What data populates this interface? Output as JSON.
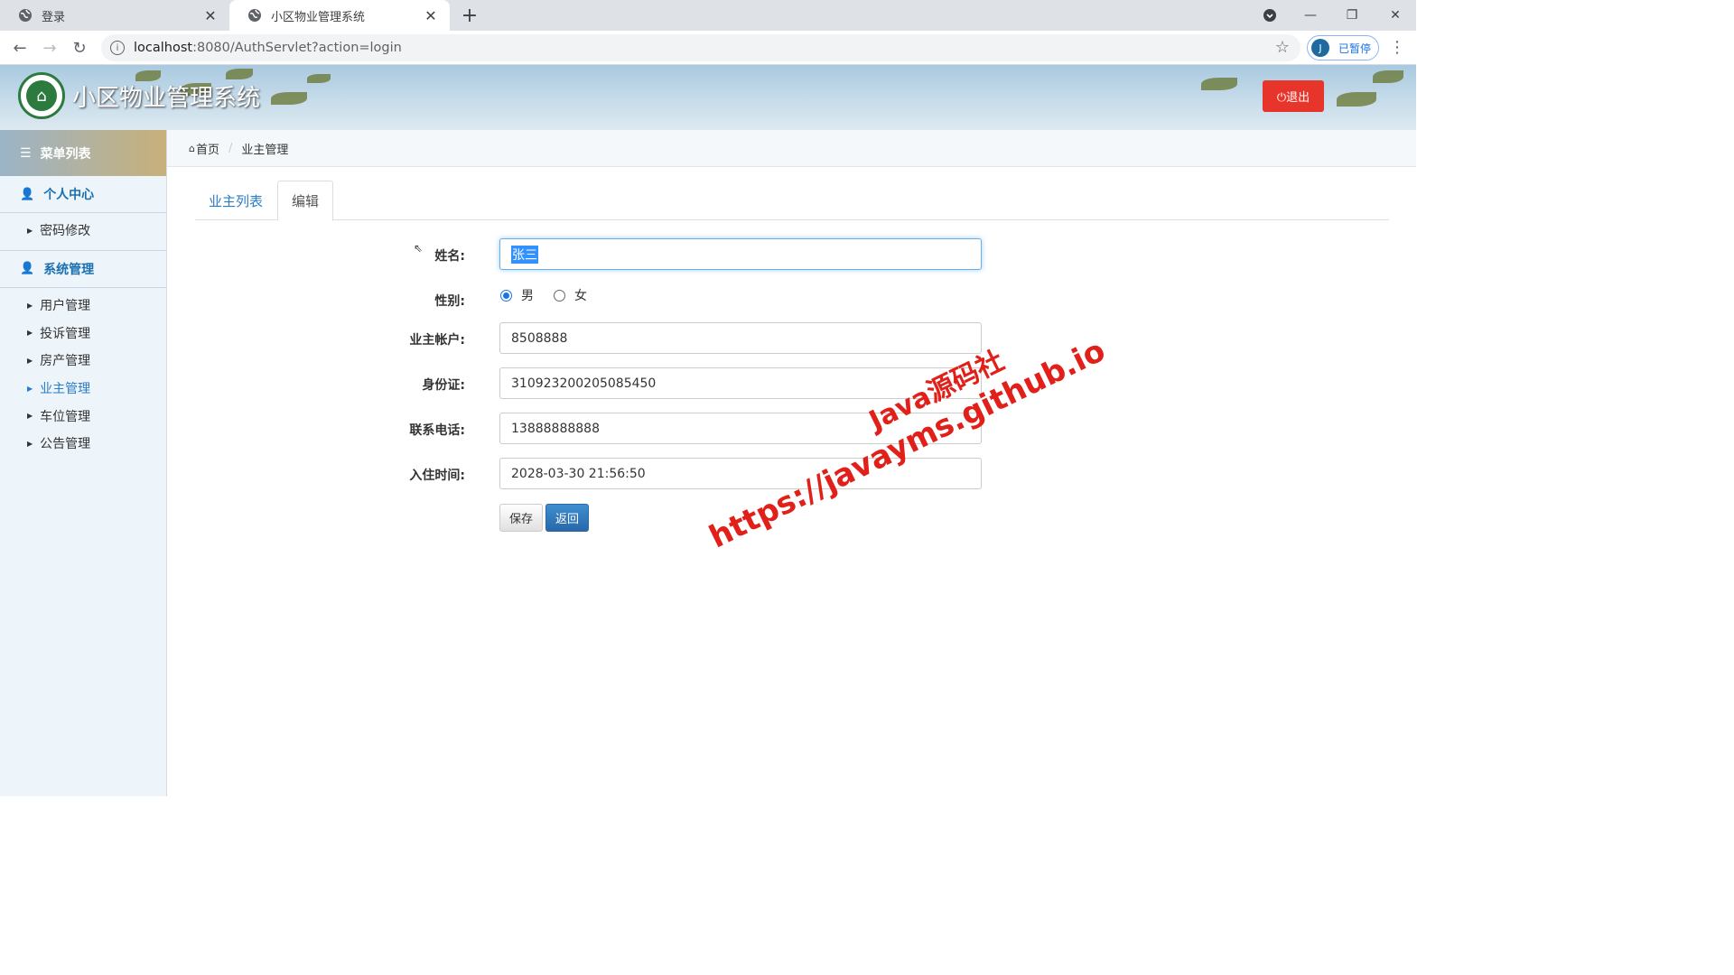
{
  "browser": {
    "tabs": [
      {
        "title": "登录",
        "active": false
      },
      {
        "title": "小区物业管理系统",
        "active": true
      }
    ],
    "url_host": "localhost",
    "url_rest": ":8080/AuthServlet?action=login",
    "profile_initial": "J",
    "profile_status": "已暂停"
  },
  "header": {
    "site_title": "小区物业管理系统",
    "logout_label": "⏻退出"
  },
  "sidebar": {
    "menu_title": "菜单列表",
    "sections": [
      {
        "label": "个人中心",
        "items": [
          "密码修改"
        ]
      },
      {
        "label": "系统管理",
        "items": [
          "用户管理",
          "投诉管理",
          "房产管理",
          "业主管理",
          "车位管理",
          "公告管理"
        ]
      }
    ],
    "active_item": "业主管理"
  },
  "breadcrumb": {
    "home": "首页",
    "current": "业主管理"
  },
  "content_tabs": [
    "业主列表",
    "编辑"
  ],
  "form": {
    "name_label": "姓名:",
    "name_value": "张三",
    "gender_label": "性别:",
    "gender_male": "男",
    "gender_female": "女",
    "gender_selected": "男",
    "account_label": "业主帐户:",
    "account_value": "8508888",
    "idcard_label": "身份证:",
    "idcard_value": "310923200205085450",
    "phone_label": "联系电话:",
    "phone_value": "13888888888",
    "checkin_label": "入住时间:",
    "checkin_value": "2028-03-30 21:56:50",
    "save_label": "保存",
    "back_label": "返回"
  },
  "watermark": {
    "line1": "Java源码社",
    "line2": "https://javayms.github.io"
  },
  "colors": {
    "accent": "#2a7cc7",
    "logout": "#e8352c",
    "watermark": "#e2201a"
  }
}
